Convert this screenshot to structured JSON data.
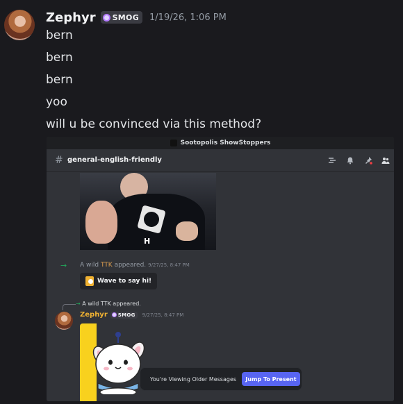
{
  "message": {
    "author": "Zephyr",
    "tag": "SMOG",
    "timestamp": "1/19/26, 1:06 PM",
    "lines": [
      "bern",
      "bern",
      "bern",
      "yoo",
      "will u be convinced via this method?"
    ]
  },
  "embedded_screenshot": {
    "server_name": "Sootopolis ShowStoppers",
    "channel_hash": "#",
    "channel_name": "general-english-friendly",
    "gif_caption": "H",
    "join_arrow": "→",
    "join_prefix": "A wild ",
    "join_user": "TTK",
    "join_suffix": " appeared.",
    "join_timestamp": "9/27/25, 8:47 PM",
    "wave_label": "Wave to say hi!",
    "reply_arrow": "→",
    "reply_preview": "A wild TTK appeared.",
    "reply_author": "Zephyr",
    "reply_tag": "SMOG",
    "reply_timestamp": "9/27/25, 8:47 PM",
    "older_messages_text": "You're Viewing Older Messages",
    "jump_button": "Jump To Present"
  },
  "colors": {
    "background": "#1a1a1e",
    "accent": "#5865f2",
    "join_green": "#23a55a",
    "reply_author": "#f0b232"
  }
}
